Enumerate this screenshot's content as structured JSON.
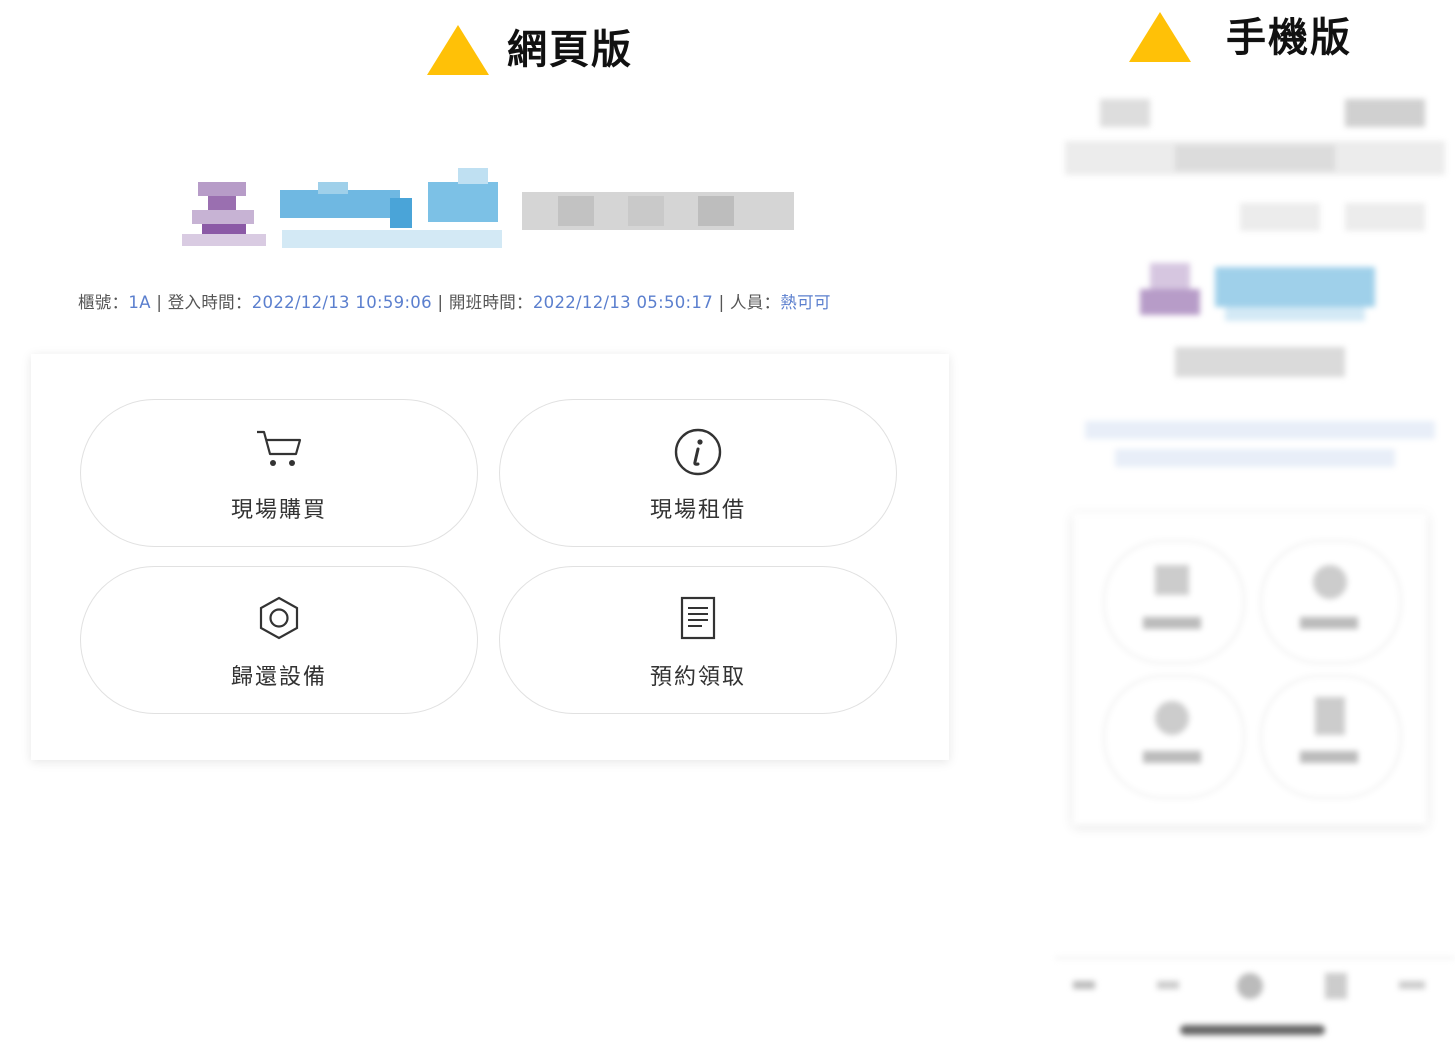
{
  "labels": {
    "web": "網頁版",
    "mobile": "手機版"
  },
  "status": {
    "counter_label": "櫃號：",
    "counter_value": "1A",
    "login_label": "登入時間：",
    "login_value": "2022/12/13 10:59:06",
    "shift_label": "開班時間：",
    "shift_value": "2022/12/13 05:50:17",
    "staff_label": "人員：",
    "staff_value": "熱可可",
    "separator": "|"
  },
  "menu": [
    {
      "label": "現場購買",
      "icon": "cart-icon"
    },
    {
      "label": "現場租借",
      "icon": "info-icon"
    },
    {
      "label": "歸還設備",
      "icon": "hexagon-nut-icon"
    },
    {
      "label": "預約領取",
      "icon": "document-icon"
    }
  ],
  "colors": {
    "accent_triangle": "#FFC107",
    "link_blue": "#5b7fce",
    "logo_purple": "#9a6fb0",
    "logo_blue": "#5aaedc"
  }
}
